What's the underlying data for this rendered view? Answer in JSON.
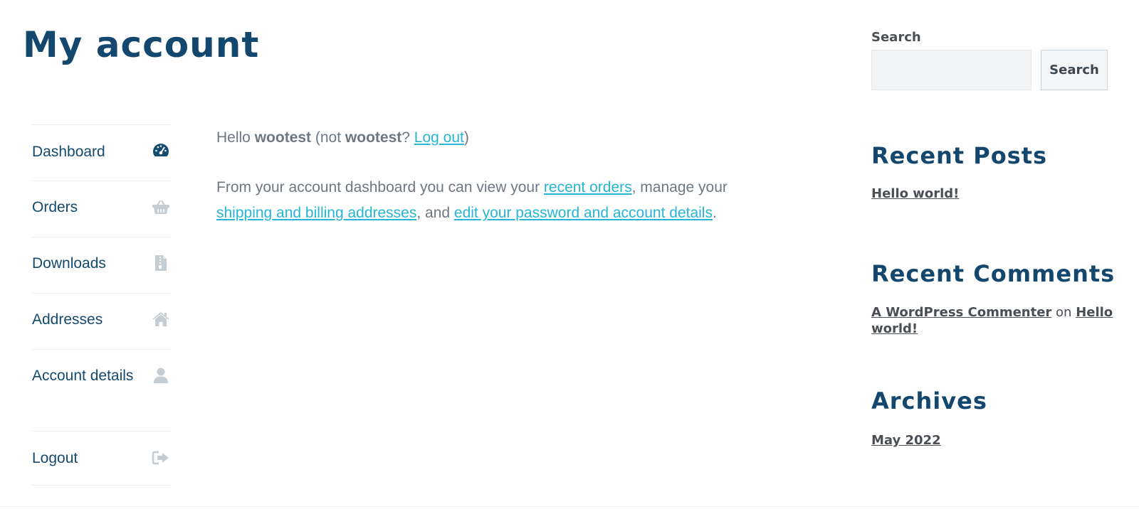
{
  "page": {
    "title": "My account"
  },
  "nav": {
    "items": [
      {
        "label": "Dashboard",
        "icon": "dashboard-icon",
        "active": true
      },
      {
        "label": "Orders",
        "icon": "basket-icon"
      },
      {
        "label": "Downloads",
        "icon": "file-icon"
      },
      {
        "label": "Addresses",
        "icon": "home-icon"
      },
      {
        "label": "Account details",
        "icon": "user-icon"
      },
      {
        "label": "Logout",
        "icon": "sign-out-icon"
      }
    ]
  },
  "greeting": {
    "hello": "Hello ",
    "username": "wootest",
    "not_open": " (not ",
    "username_2": "wootest",
    "question": "? ",
    "logout_link": "Log out",
    "close": ")"
  },
  "intro": {
    "part1": "From your account dashboard you can view your ",
    "recent_orders_link": "recent orders",
    "part2": ", manage your ",
    "addresses_link": "shipping and billing addresses",
    "part3": ", and ",
    "account_link": "edit your password and account details",
    "part4": "."
  },
  "sidebar": {
    "search": {
      "label": "Search",
      "placeholder": "",
      "button": "Search"
    },
    "recent_posts": {
      "title": "Recent Posts",
      "items": [
        "Hello world!"
      ]
    },
    "recent_comments": {
      "title": "Recent Comments",
      "author": "A WordPress Commenter",
      "on": " on ",
      "post": "Hello world!"
    },
    "archives": {
      "title": "Archives",
      "items": [
        "May 2022"
      ]
    }
  },
  "colors": {
    "heading": "#13476e",
    "link": "#26b6d3",
    "body_text": "#6e7781",
    "nav_icon_active": "#134a70",
    "nav_icon_muted": "#c5cdd4"
  }
}
